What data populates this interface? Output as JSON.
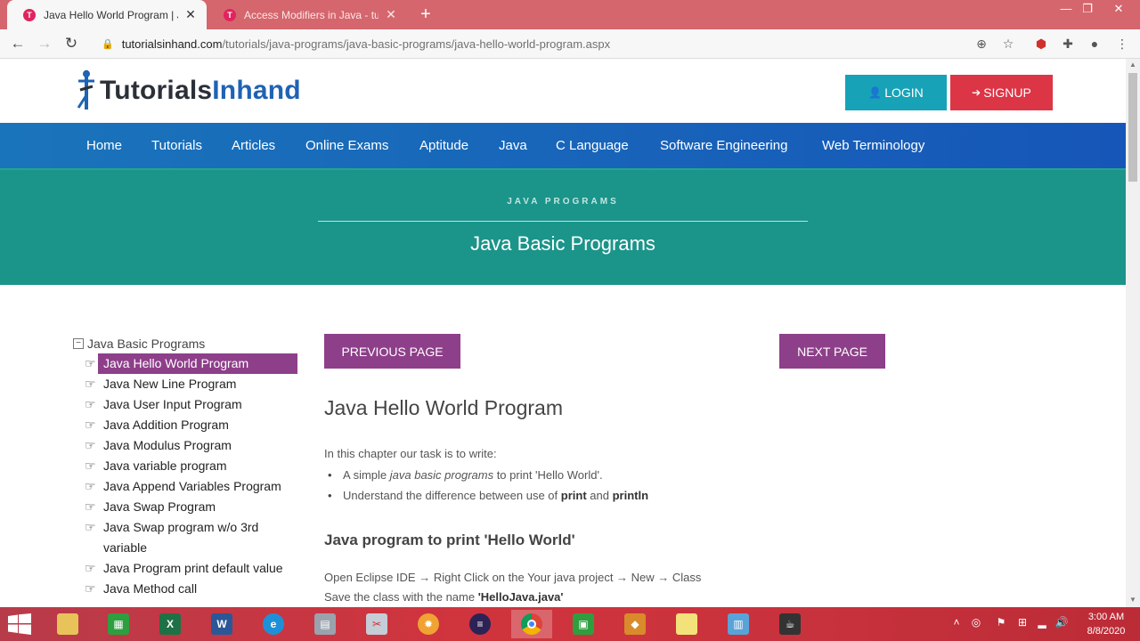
{
  "browser": {
    "tabs": [
      {
        "title": "Java Hello World Program | Java",
        "active": true
      },
      {
        "title": "Access Modifiers in Java - tutoria",
        "active": false
      }
    ],
    "url_host": "tutorialsinhand.com",
    "url_path": "/tutorials/java-programs/java-basic-programs/java-hello-world-program.aspx"
  },
  "site": {
    "logo_part1": "Tutorials",
    "logo_part2": "Inhand",
    "login_label": "LOGIN",
    "signup_label": "SIGNUP"
  },
  "nav": [
    "Home",
    "Tutorials",
    "Articles",
    "Online Exams",
    "Aptitude",
    "Java",
    "C Language",
    "Software Engineering",
    "Web Terminology"
  ],
  "banner": {
    "kicker": "JAVA PROGRAMS",
    "title": "Java Basic Programs"
  },
  "sidebar": {
    "root_toggle": "−",
    "root_label": "Java Basic Programs",
    "items": [
      "Java Hello World Program",
      "Java New Line Program",
      "Java User Input Program",
      "Java Addition Program",
      "Java Modulus Program",
      "Java variable program",
      "Java Append Variables Program",
      "Java Swap Program",
      "Java Swap program w/o 3rd variable",
      "Java Program print default value",
      "Java Method call"
    ]
  },
  "content": {
    "prev_label": "PREVIOUS PAGE",
    "next_label": "NEXT PAGE",
    "title": "Java Hello World Program",
    "intro": "In this chapter our task is to write:",
    "bullet1_pre": "A simple ",
    "bullet1_em": "java basic programs",
    "bullet1_post": " to print 'Hello World'.",
    "bullet2_pre": "Understand the difference between use of ",
    "bullet2_b1": "print",
    "bullet2_mid": " and ",
    "bullet2_b2": "println",
    "section_title": "Java program to print 'Hello World'",
    "step1": "Open Eclipse IDE → Right Click on the Your java project → New → Class",
    "step2_pre": "Save the class with the name ",
    "step2_b": "'HelloJava.java'"
  },
  "taskbar": {
    "time": "3:00 AM",
    "date": "8/8/2020"
  },
  "colors": {
    "tab_strip": "#d5666d",
    "nav_blue": "#1656b8",
    "banner_teal": "#1b948a",
    "login": "#17a2b8",
    "signup": "#dc3545",
    "purple": "#8e3f8a"
  }
}
